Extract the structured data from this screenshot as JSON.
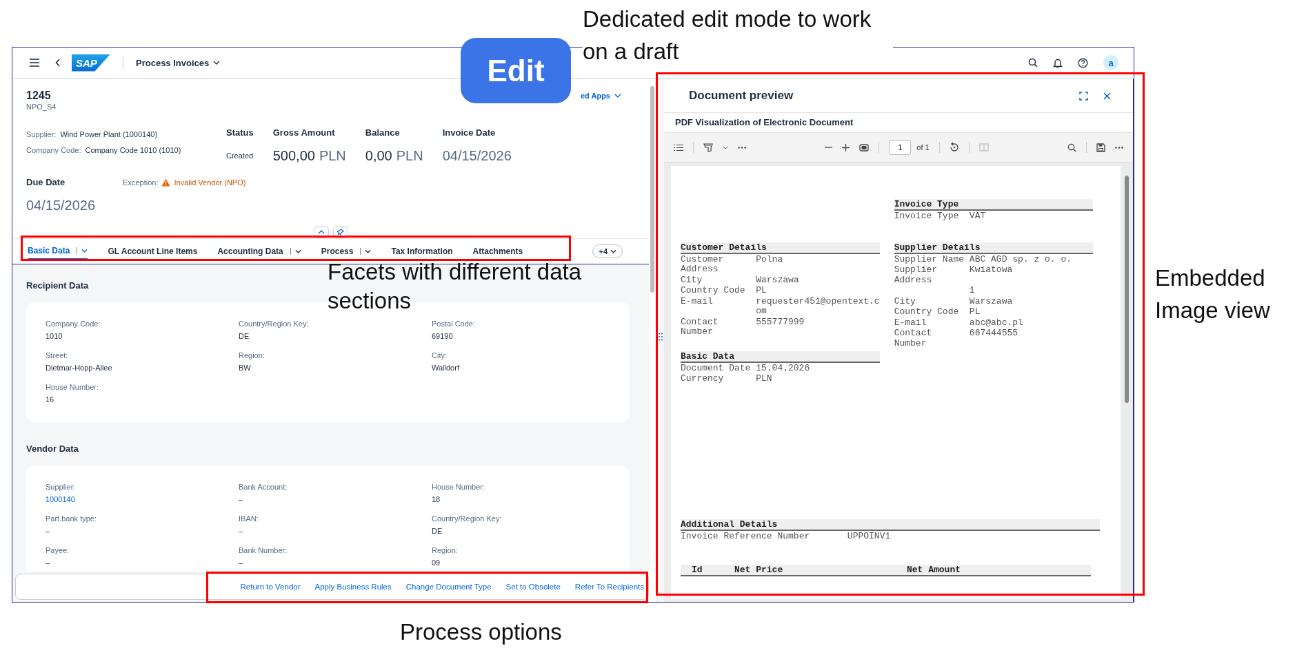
{
  "callouts": [
    {
      "text": "Dedicated edit mode to work on a draft"
    },
    {
      "text": "Facets with different data sections"
    },
    {
      "text": "Embedded Image view"
    },
    {
      "text": "Process options"
    }
  ],
  "edit_badge": "Edit",
  "shell": {
    "logo": "SAP",
    "title": "Process Invoices",
    "avatar": "a"
  },
  "header": {
    "object_title": "1245",
    "subtitle": "NPO_S4",
    "related_apps": "ed Apps",
    "attributes": [
      {
        "label": "Supplier:",
        "value": "Wind Power Plant (1000140)"
      },
      {
        "label": "Company Code:",
        "value": "Company Code 1010 (1010)"
      }
    ],
    "kpis": [
      {
        "kind": "text",
        "label": "Status",
        "value": "Created"
      },
      {
        "kind": "amount",
        "label": "Gross Amount",
        "value": "500,00",
        "unit": "PLN"
      },
      {
        "kind": "amount",
        "label": "Balance",
        "value": "0,00",
        "unit": "PLN"
      },
      {
        "kind": "date",
        "label": "Invoice Date",
        "value": "04/15/2026"
      }
    ],
    "due_date": {
      "label": "Due Date",
      "value": "04/15/2026"
    },
    "exception": {
      "label": "Exception:",
      "value": "Invalid Vendor (NPO)"
    }
  },
  "tabs": [
    {
      "label": "Basic Data",
      "selected": true,
      "has_menu": true
    },
    {
      "label": "GL Account Line Items",
      "selected": false,
      "has_menu": false
    },
    {
      "label": "Accounting Data",
      "selected": false,
      "has_menu": true
    },
    {
      "label": "Process",
      "selected": false,
      "has_menu": true
    },
    {
      "label": "Tax Information",
      "selected": false,
      "has_menu": false
    },
    {
      "label": "Attachments",
      "selected": false,
      "has_menu": false
    }
  ],
  "tab_overflow": "+4",
  "sections": [
    {
      "title": "Recipient Data",
      "fields": [
        {
          "kind": "text",
          "label": "Company Code:",
          "value": "1010"
        },
        {
          "kind": "text",
          "label": "Country/Region Key:",
          "value": "DE"
        },
        {
          "kind": "text",
          "label": "Postal Code:",
          "value": "69190"
        },
        {
          "kind": "text",
          "label": "Street:",
          "value": "Dietmar-Hopp-Allee"
        },
        {
          "kind": "text",
          "label": "Region:",
          "value": "BW"
        },
        {
          "kind": "text",
          "label": "City:",
          "value": "Walldorf"
        },
        {
          "kind": "text",
          "label": "House Number:",
          "value": "16"
        }
      ]
    },
    {
      "title": "Vendor Data",
      "fields": [
        {
          "kind": "link",
          "label": "Supplier:",
          "value": "1000140"
        },
        {
          "kind": "text",
          "label": "Bank Account:",
          "value": "–"
        },
        {
          "kind": "text",
          "label": "House Number:",
          "value": "18"
        },
        {
          "kind": "text",
          "label": "Part.bank type:",
          "value": "–"
        },
        {
          "kind": "text",
          "label": "IBAN:",
          "value": "–"
        },
        {
          "kind": "text",
          "label": "Country/Region Key:",
          "value": "DE"
        },
        {
          "kind": "text",
          "label": "Payee:",
          "value": "–"
        },
        {
          "kind": "text",
          "label": "Bank Number:",
          "value": "–"
        },
        {
          "kind": "text",
          "label": "Region:",
          "value": "09"
        }
      ]
    }
  ],
  "actions": [
    "Return to Vendor",
    "Apply Business Rules",
    "Change Document Type",
    "Set to Obsolete",
    "Refer To Recipients"
  ],
  "preview": {
    "title": "Document preview",
    "subtitle": "PDF Visualization of Electronic Document",
    "page": "1",
    "page_count": "of 1",
    "document": {
      "invoice_type": {
        "heading": "Invoice Type",
        "rows": [
          {
            "label": "Invoice Type",
            "value": "VAT"
          }
        ]
      },
      "customer": {
        "heading": "Customer Details",
        "rows": [
          {
            "label": "Customer Address",
            "value": "Polna"
          },
          {
            "label": "City",
            "value": "Warszawa"
          },
          {
            "label": "Country Code",
            "value": "PL"
          },
          {
            "label": "E-mail",
            "value": "requester451@opentext.com"
          },
          {
            "label": "Contact Number",
            "value": "555777999"
          }
        ]
      },
      "supplier": {
        "heading": "Supplier Details",
        "rows": [
          {
            "label": "Supplier Name",
            "value": "ABC AGD sp. z o. o."
          },
          {
            "label": "Supplier Address",
            "value": "Kwiatowa"
          },
          {
            "value": "1"
          },
          {
            "label": "City",
            "value": "Warszawa"
          },
          {
            "label": "Country Code",
            "value": "PL"
          },
          {
            "label": "E-mail",
            "value": "abc@abc.pl"
          },
          {
            "label": "Contact Number",
            "value": "667444555"
          }
        ]
      },
      "basic_data": {
        "heading": "Basic Data",
        "rows": [
          {
            "label": "Document Date",
            "value": "15.04.2026"
          },
          {
            "label": "Currency",
            "value": "PLN"
          }
        ]
      },
      "additional": {
        "heading": "Additional Details",
        "rows": [
          {
            "label": "Invoice Reference Number",
            "value": "UPPOINV1"
          }
        ]
      },
      "table_columns": [
        "Id",
        "Net Price",
        "Net Amount"
      ]
    }
  }
}
